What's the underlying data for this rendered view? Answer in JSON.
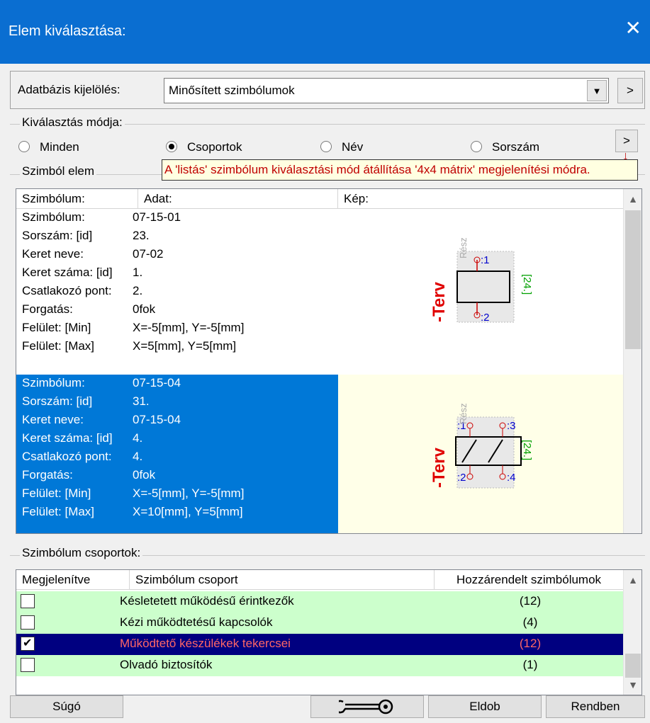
{
  "titlebar": {
    "title": "Elem kiválasztása:",
    "close": "✕"
  },
  "database": {
    "label": "Adatbázis kijelölés:",
    "value": "Minősített szimbólumok",
    "next": ">"
  },
  "mode": {
    "title": "Kiválasztás módja:",
    "options": [
      "Minden",
      "Csoportok",
      "Név",
      "Sorszám"
    ],
    "selected": "Csoportok",
    "next": ">"
  },
  "tooltip": "A 'listás' szimbólum kiválasztási mód átállítása '4x4 mátrix' megjelenítési módra.",
  "elements": {
    "title": "Szimból elem",
    "columns": [
      "Szimbólum:",
      "Adat:",
      "Kép:"
    ],
    "records": [
      {
        "fields": [
          {
            "k": "Szimbólum:",
            "v": "07-15-01"
          },
          {
            "k": "Sorszám: [id]",
            "v": "23."
          },
          {
            "k": "Keret neve:",
            "v": "07-02"
          },
          {
            "k": "Keret száma: [id]",
            "v": "1."
          },
          {
            "k": "Csatlakozó pont:",
            "v": "2."
          },
          {
            "k": "Forgatás:",
            "v": "0fok"
          },
          {
            "k": "Felület: [Min]",
            "v": "X=-5[mm], Y=-5[mm]"
          },
          {
            "k": "Felület: [Max]",
            "v": "X=5[mm], Y=5[mm]"
          }
        ],
        "image": {
          "terv": "-Terv",
          "resz": "Rész",
          "dim": "[24.]",
          "pins": [
            ":1",
            ":2"
          ]
        }
      },
      {
        "fields": [
          {
            "k": "Szimbólum:",
            "v": "07-15-04"
          },
          {
            "k": "Sorszám: [id]",
            "v": "31."
          },
          {
            "k": "Keret neve:",
            "v": "07-15-04"
          },
          {
            "k": "Keret száma: [id]",
            "v": "4."
          },
          {
            "k": "Csatlakozó pont:",
            "v": "4."
          },
          {
            "k": "Forgatás:",
            "v": "0fok"
          },
          {
            "k": "Felület: [Min]",
            "v": "X=-5[mm], Y=-5[mm]"
          },
          {
            "k": "Felület: [Max]",
            "v": "X=10[mm], Y=5[mm]"
          }
        ],
        "image": {
          "terv": "-Terv",
          "resz": "Rész",
          "dim": "[24.]",
          "pins": [
            ":1",
            ":3",
            ":2",
            ":4"
          ]
        }
      }
    ]
  },
  "groups": {
    "title": "Szimbólum csoportok:",
    "columns": [
      "Megjelenítve",
      "Szimbólum csoport",
      "Hozzárendelt szimbólumok"
    ],
    "rows": [
      {
        "checked": false,
        "name": "Késletetett működésű érintkezők",
        "count": "(12)"
      },
      {
        "checked": false,
        "name": "Kézi működtetésű kapcsolók",
        "count": "(4)"
      },
      {
        "checked": true,
        "name": "Működtető készülékek tekercsei",
        "count": "(12)"
      },
      {
        "checked": false,
        "name": "Olvadó biztosítók",
        "count": "(1)"
      }
    ]
  },
  "buttons": {
    "help": "Súgó",
    "discard": "Eldob",
    "ok": "Rendben",
    "tool_icon": "wrench-icon"
  }
}
